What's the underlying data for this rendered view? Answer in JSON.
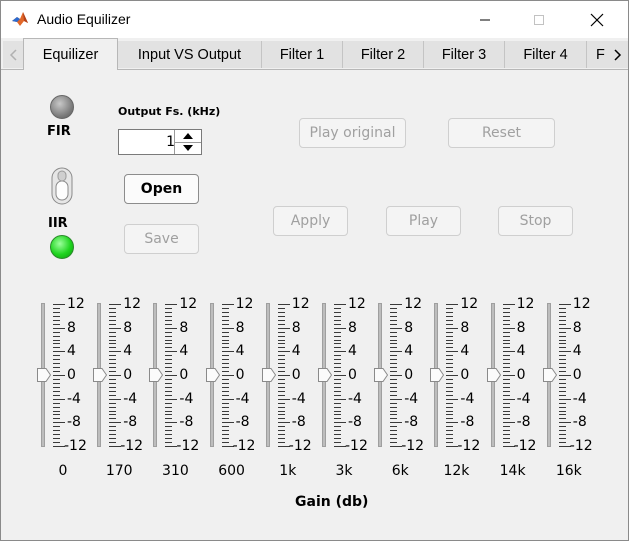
{
  "window": {
    "title": "Audio Equilizer"
  },
  "tabs": [
    {
      "label": "Equilizer",
      "active": true
    },
    {
      "label": "Input VS Output"
    },
    {
      "label": "Filter 1"
    },
    {
      "label": "Filter 2"
    },
    {
      "label": "Filter 3"
    },
    {
      "label": "Filter 4"
    },
    {
      "label": "F"
    }
  ],
  "filter_type": {
    "fir_label": "FIR",
    "iir_label": "IIR",
    "fir_lamp": "gray",
    "iir_lamp": "green",
    "toggle_state": "IIR"
  },
  "output_fs": {
    "label": "Output Fs. (kHz)",
    "value": "1"
  },
  "buttons": {
    "open": "Open",
    "save": "Save",
    "play_original": "Play original",
    "reset": "Reset",
    "apply": "Apply",
    "play": "Play",
    "stop": "Stop"
  },
  "scale_labels": [
    "12",
    "8",
    "4",
    "0",
    "-4",
    "-8",
    "-12"
  ],
  "bands": [
    {
      "label": "0",
      "gain": 0
    },
    {
      "label": "170",
      "gain": 0
    },
    {
      "label": "310",
      "gain": 0
    },
    {
      "label": "600",
      "gain": 0
    },
    {
      "label": "1k",
      "gain": 0
    },
    {
      "label": "3k",
      "gain": 0
    },
    {
      "label": "6k",
      "gain": 0
    },
    {
      "label": "12k",
      "gain": 0
    },
    {
      "label": "14k",
      "gain": 0
    },
    {
      "label": "16k",
      "gain": 0
    }
  ],
  "gain_axis_label": "Gain (db)",
  "colors": {
    "lamp_on": "#1fd41f",
    "lamp_off": "#7a7a7a",
    "disabled_text": "#a0a0a0"
  }
}
